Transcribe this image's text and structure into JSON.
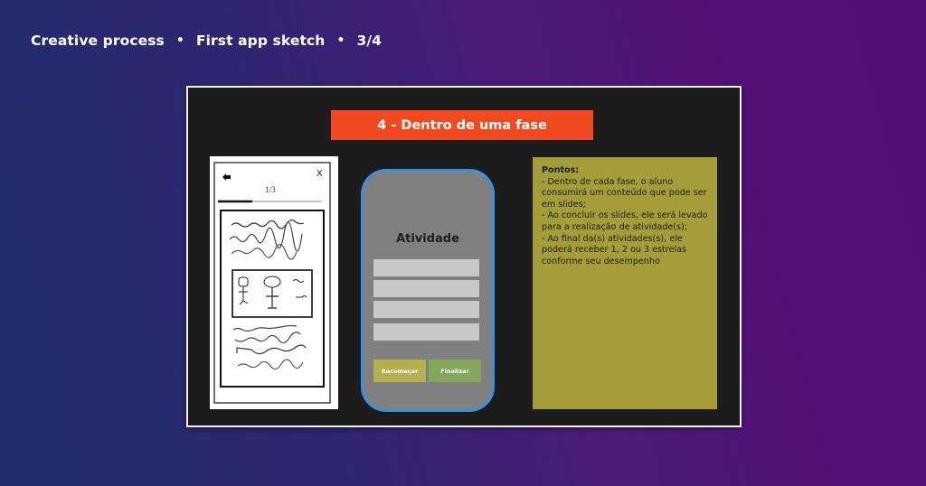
{
  "header": {
    "crumbs": [
      "Creative process",
      "First app sketch",
      "3/4"
    ],
    "separator": "•"
  },
  "slide": {
    "title": "4 - Dentro de uma fase",
    "title_color": "#f04a23",
    "sketch": {
      "back_icon": "arrow-left-icon",
      "close_label": "X",
      "counter": "1/3",
      "progress": 0.33
    },
    "phone": {
      "title": "Atividade",
      "fields": [
        "",
        "",
        "",
        ""
      ],
      "buttons": {
        "restart": "Recomeçar",
        "finish": "Finalizar"
      },
      "border_color": "#3b8fdb"
    },
    "notes": {
      "title": "Pontos:",
      "lines": [
        "- Dentro de cada fase, o aluno consumirá um conteúdo que pode ser em slides;",
        "- Ao concluir os slides, ele será levado para a realização de atividade(s);",
        "- Ao final da(s) atividades(s), ele poderá receber 1, 2 ou 3 estrelas conforme seu desempenho"
      ],
      "background": "#a49d39"
    }
  }
}
